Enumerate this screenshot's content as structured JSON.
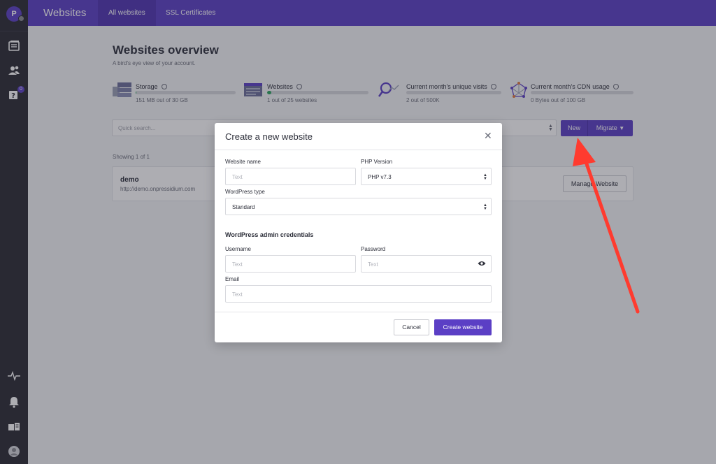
{
  "sidebar": {
    "avatar_letter": "P",
    "badge_count": "0",
    "icons": [
      "websites-icon",
      "users-icon",
      "help-icon",
      "activity-icon",
      "bell-icon",
      "news-icon",
      "profile-icon"
    ]
  },
  "topbar": {
    "title": "Websites",
    "tabs": [
      {
        "label": "All websites",
        "active": true
      },
      {
        "label": "SSL Certificates",
        "active": false
      }
    ]
  },
  "overview": {
    "title": "Websites overview",
    "subtitle": "A bird's eye view of your account."
  },
  "stats": [
    {
      "label": "Storage",
      "value": "151 MB out of 30 GB",
      "fill_percent": 0.5
    },
    {
      "label": "Websites",
      "value": "1 out of 25 websites",
      "fill_percent": 4
    },
    {
      "label": "Current month's unique visits",
      "value": "2 out of 500K",
      "fill_percent": 0
    },
    {
      "label": "Current month's CDN usage",
      "value": "0 Bytes out of 100 GB",
      "fill_percent": 0
    }
  ],
  "toolbar": {
    "search_placeholder": "Quick search...",
    "new_label": "New",
    "migrate_label": "Migrate"
  },
  "list": {
    "showing": "Showing 1 of 1",
    "sites": [
      {
        "name": "demo",
        "url": "http://demo.onpressidium.com",
        "manage_label": "Manage Website"
      }
    ]
  },
  "modal": {
    "title": "Create a new website",
    "website_name_label": "Website name",
    "website_name_placeholder": "Text",
    "php_version_label": "PHP Version",
    "php_version_value": "PHP v7.3",
    "wp_type_label": "WordPress type",
    "wp_type_value": "Standard",
    "credentials_title": "WordPress admin credentials",
    "username_label": "Username",
    "username_placeholder": "Text",
    "password_label": "Password",
    "password_placeholder": "Text",
    "email_label": "Email",
    "email_placeholder": "Text",
    "cancel_label": "Cancel",
    "create_label": "Create website"
  },
  "colors": {
    "brand": "#5b3fc5",
    "sidebar": "#2a2b33",
    "progress": "#2aa55e",
    "annotation_arrow": "#ff3b2f"
  }
}
